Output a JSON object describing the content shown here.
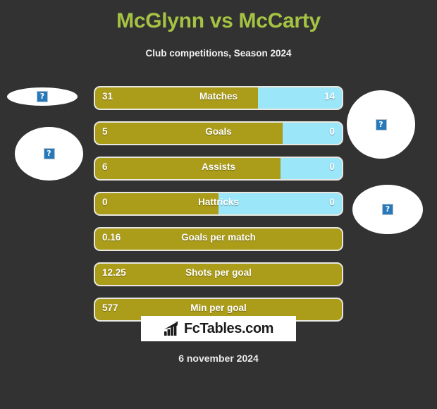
{
  "header": {
    "title": "McGlynn vs McCarty",
    "subtitle": "Club competitions, Season 2024"
  },
  "avatars": {
    "home_flag_alt": "?",
    "home_face_alt": "?",
    "away_face_alt": "?",
    "away_flag_alt": "?"
  },
  "chart_data": {
    "type": "bar",
    "title": "McGlynn vs McCarty",
    "subtitle": "Club competitions, Season 2024",
    "orientation": "horizontal-diverging",
    "series": [
      {
        "name": "McGlynn",
        "color": "#ab9c19"
      },
      {
        "name": "McCarty",
        "color": "#9ce6fa"
      }
    ],
    "categories": [
      "Matches",
      "Goals",
      "Assists",
      "Hattricks",
      "Goals per match",
      "Shots per goal",
      "Min per goal"
    ],
    "rows": [
      {
        "label": "Matches",
        "home": "31",
        "away": "14",
        "home_pct": 66,
        "two_sided": true
      },
      {
        "label": "Goals",
        "home": "5",
        "away": "0",
        "home_pct": 76,
        "two_sided": true
      },
      {
        "label": "Assists",
        "home": "6",
        "away": "0",
        "home_pct": 75,
        "two_sided": true
      },
      {
        "label": "Hattricks",
        "home": "0",
        "away": "0",
        "home_pct": 50,
        "two_sided": true
      },
      {
        "label": "Goals per match",
        "home": "0.16",
        "away": "",
        "home_pct": 100,
        "two_sided": false
      },
      {
        "label": "Shots per goal",
        "home": "12.25",
        "away": "",
        "home_pct": 100,
        "two_sided": false
      },
      {
        "label": "Min per goal",
        "home": "577",
        "away": "",
        "home_pct": 100,
        "two_sided": false
      }
    ]
  },
  "footer": {
    "logo_text": "FcTables.com",
    "date": "6 november 2024"
  },
  "colors": {
    "background": "#333232",
    "title": "#a5c343",
    "home_bar": "#ab9c19",
    "away_bar": "#9ce6fa",
    "bar_outline": "#e8e8e0"
  }
}
